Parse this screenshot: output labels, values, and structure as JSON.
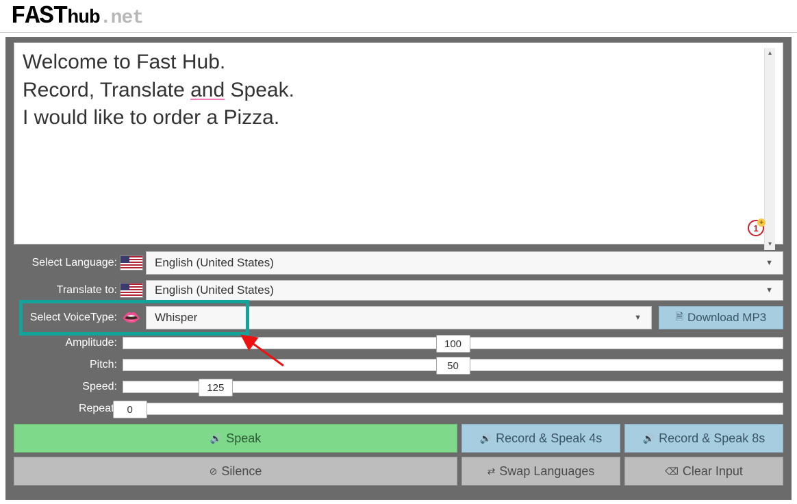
{
  "logo": {
    "fast": "FAST",
    "hub": "hub",
    "net": ".net"
  },
  "editor": {
    "line1": "Welcome to Fast Hub.",
    "line2a": "Record, Translate ",
    "line2u": "and",
    "line2b": " Speak.",
    "line3": "I would like to order a Pizza.",
    "badge": "1"
  },
  "labels": {
    "language": "Select Language",
    "translate": "Translate to",
    "voice": "Select VoiceType",
    "amplitude": "Amplitude",
    "pitch": "Pitch",
    "speed": "Speed",
    "repeat": "Repeat"
  },
  "selects": {
    "language": "English (United States)",
    "translate": "English (United States)",
    "voice": "Whisper"
  },
  "sliders": {
    "amplitude": "100",
    "pitch": "50",
    "speed": "125",
    "repeat": "0"
  },
  "buttons": {
    "download": "Download MP3",
    "speak": "Speak",
    "silence": "Silence",
    "record4": "Record & Speak 4s",
    "record8": "Record & Speak 8s",
    "swap": "Swap Languages",
    "clear": "Clear Input"
  },
  "icons": {
    "lips": "👄"
  }
}
